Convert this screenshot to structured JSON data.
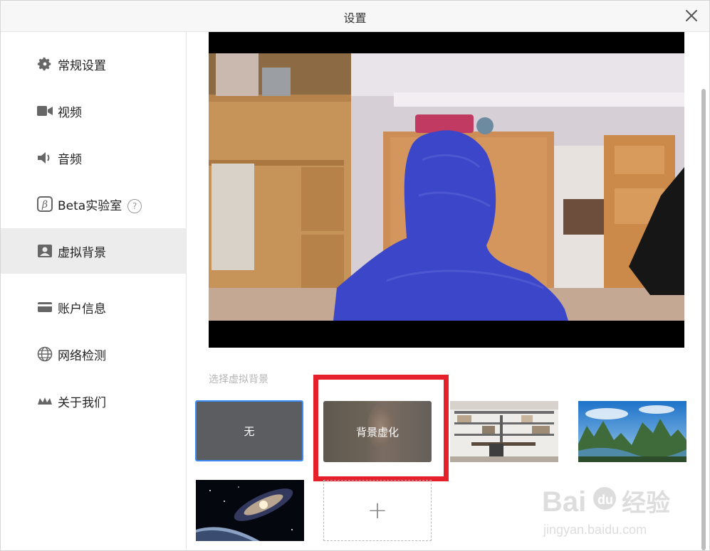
{
  "window": {
    "title": "设置",
    "close_label": "×"
  },
  "sidebar": {
    "items": [
      {
        "label": "常规设置",
        "icon": "gear-icon"
      },
      {
        "label": "视频",
        "icon": "video-camera-icon"
      },
      {
        "label": "音频",
        "icon": "speaker-icon"
      },
      {
        "label": "Beta实验室",
        "icon": "beta-icon",
        "help": "?"
      },
      {
        "label": "虚拟背景",
        "icon": "portrait-icon",
        "active": true
      },
      {
        "label": "账户信息",
        "icon": "card-icon"
      },
      {
        "label": "网络检测",
        "icon": "globe-icon"
      },
      {
        "label": "关于我们",
        "icon": "crown-icon"
      }
    ]
  },
  "main": {
    "section_label": "选择虚拟背景",
    "backgrounds": [
      {
        "label": "无",
        "selected": true
      },
      {
        "label": "背景虚化",
        "highlighted": true
      },
      {
        "label": "",
        "type": "study-room-image"
      },
      {
        "label": "",
        "type": "mountains-image"
      },
      {
        "label": "",
        "type": "galaxy-image"
      }
    ],
    "add_label": "+"
  },
  "watermark": {
    "brand": "Bai",
    "paw": "du",
    "cn": "经验",
    "url": "jingyan.baidu.com"
  },
  "colors": {
    "accent": "#3d8bf5",
    "highlight": "#e5202a",
    "person_silhouette": "#3b46c8"
  }
}
